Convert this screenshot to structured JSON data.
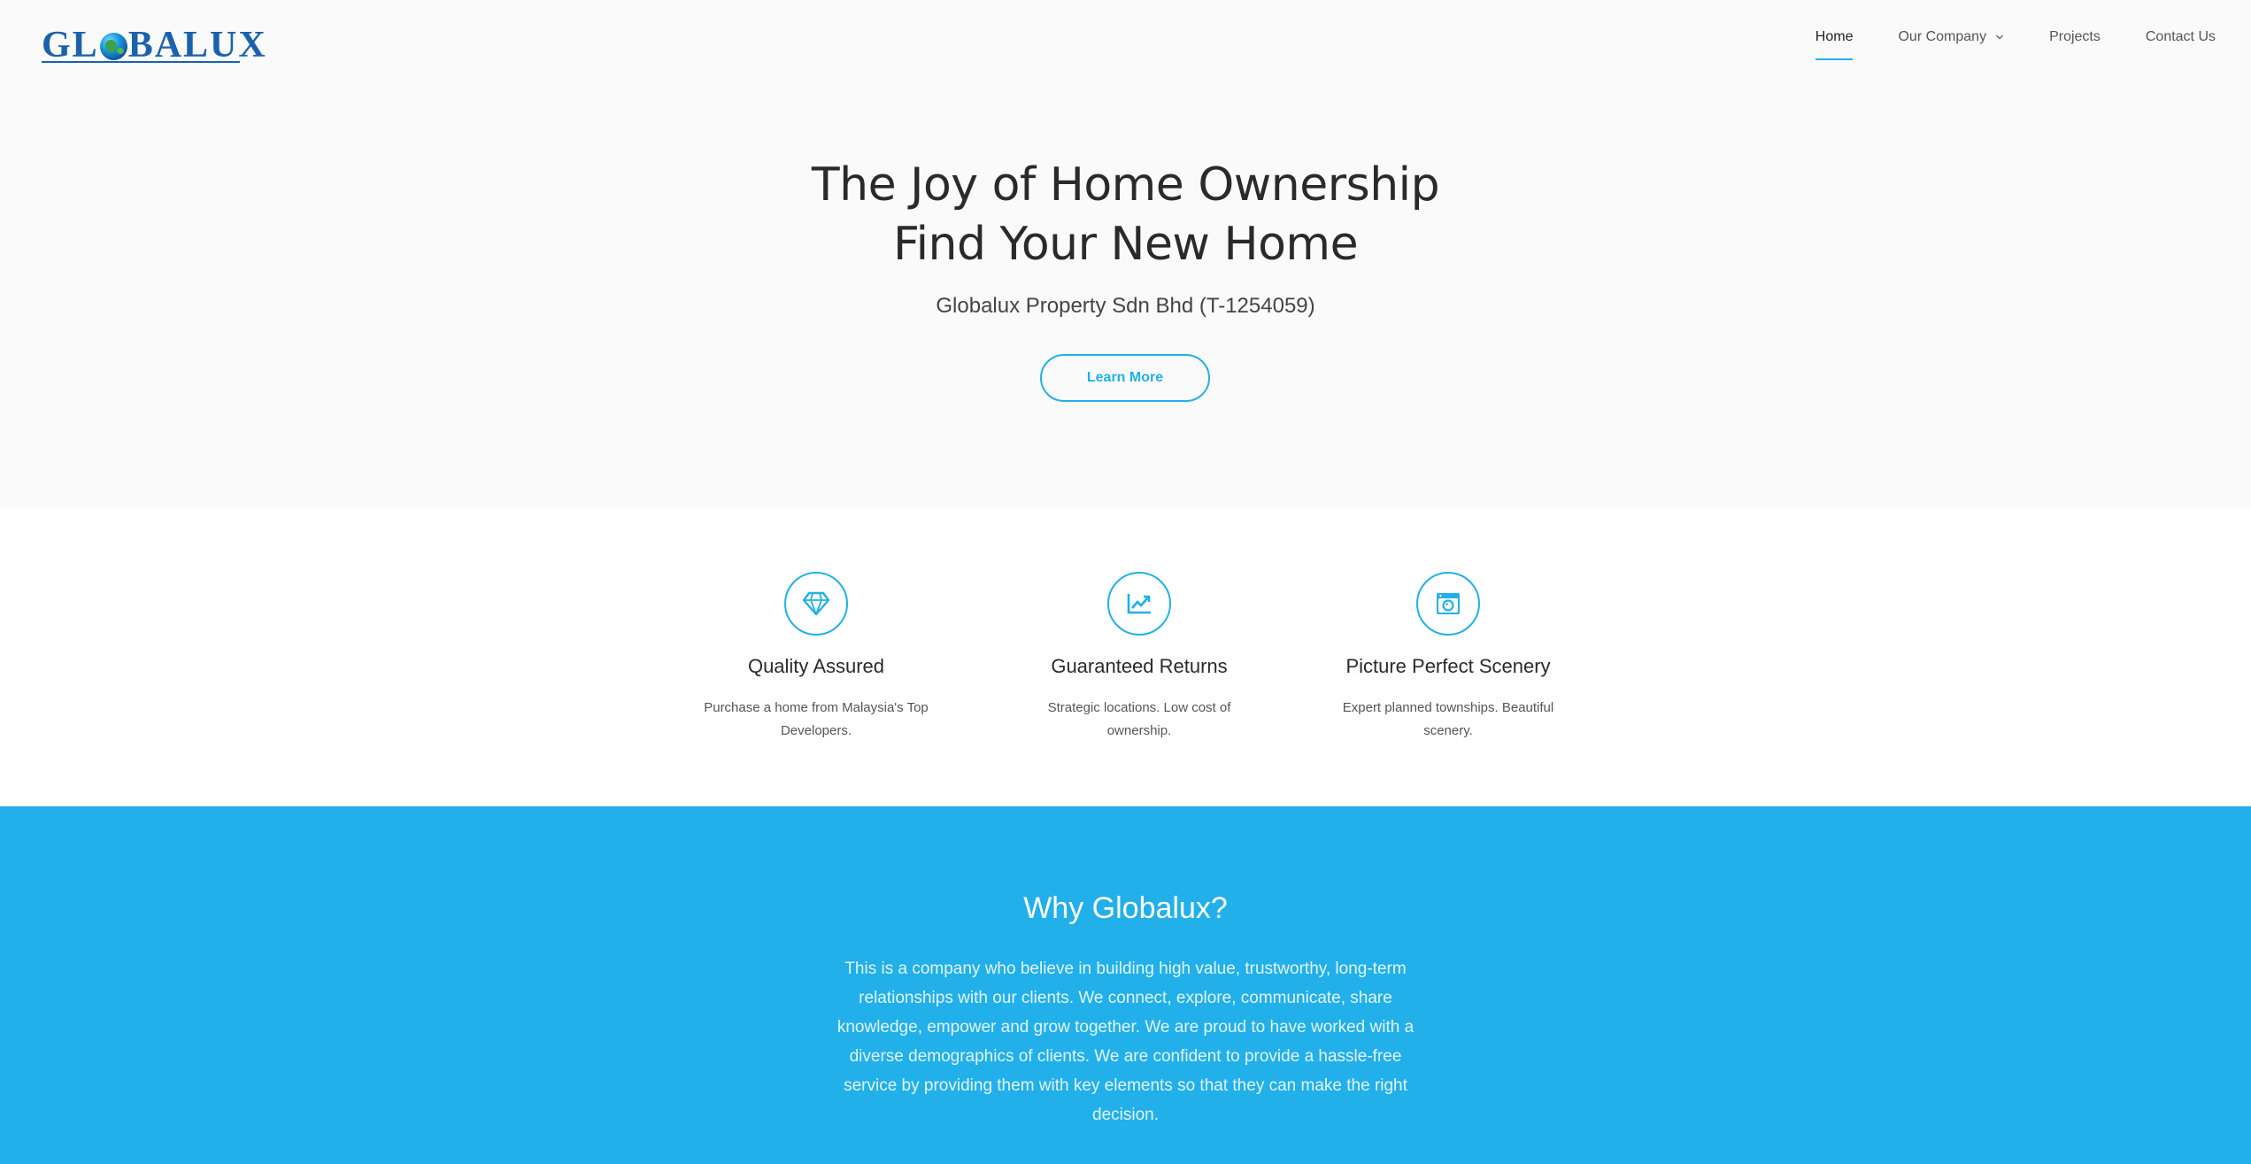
{
  "brand": {
    "logo_text_before": "GL",
    "logo_text_after": "BALUX"
  },
  "nav": {
    "items": [
      {
        "label": "Home",
        "active": true
      },
      {
        "label": "Our Company",
        "has_dropdown": true
      },
      {
        "label": "Projects"
      },
      {
        "label": "Contact Us"
      }
    ]
  },
  "hero": {
    "title_line1": "The Joy of Home Ownership",
    "title_line2": "Find Your New Home",
    "subtitle": "Globalux Property Sdn Bhd (T-1254059)",
    "cta_label": "Learn More"
  },
  "features": [
    {
      "icon": "diamond-icon",
      "title": "Quality Assured",
      "desc": "Purchase a home from Malaysia's Top Developers."
    },
    {
      "icon": "trend-chart-icon",
      "title": "Guaranteed Returns",
      "desc": "Strategic locations. Low cost of ownership."
    },
    {
      "icon": "camera-icon",
      "title": "Picture Perfect Scenery",
      "desc": "Expert planned townships. Beautiful scenery."
    }
  ],
  "why": {
    "title": "Why Globalux?",
    "text": "This is a company who believe in building high value, trustworthy, long-term relationships with our clients. We connect, explore, communicate, share knowledge, empower and grow together. We are proud to have worked with a diverse demographics of clients. We are confident to provide a hassle-free service by providing them with key elements so that they can make the right decision."
  },
  "colors": {
    "accent": "#22b0ea",
    "brand_blue": "#1a62ad",
    "hero_bg": "#fafafa"
  }
}
